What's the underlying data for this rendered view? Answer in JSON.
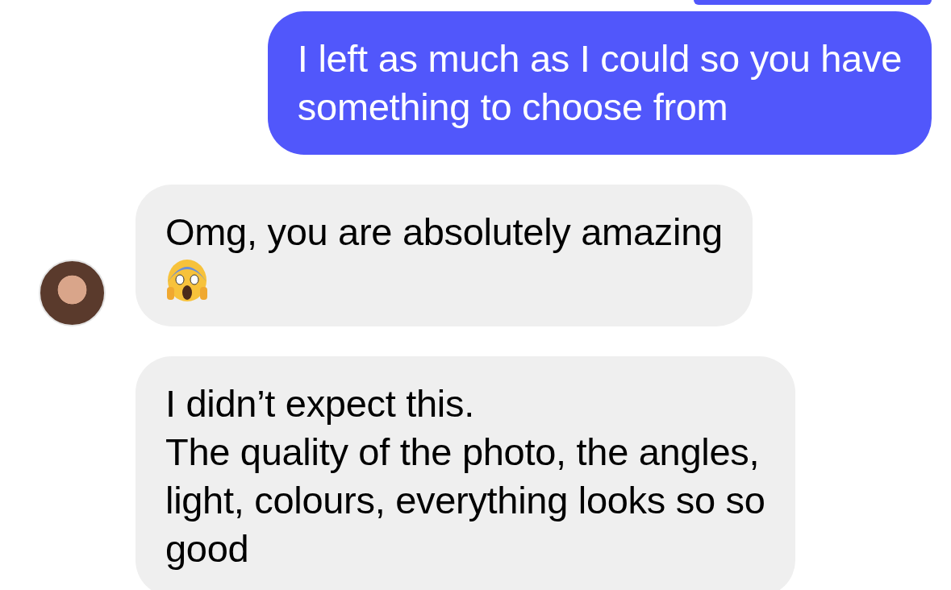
{
  "messages": [
    {
      "kind": "outgoing",
      "text": "I left as much as I could so you have\nsomething to choose from"
    },
    {
      "kind": "incoming",
      "text": "Omg, you are absolutely amazing",
      "emoji": true,
      "avatar": true
    },
    {
      "kind": "incoming",
      "text": "I didn’t expect this.\nThe quality of the photo, the angles,\nlight, colours, everything looks so so\ngood"
    }
  ]
}
